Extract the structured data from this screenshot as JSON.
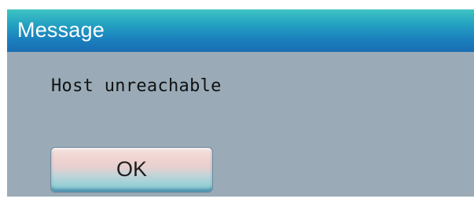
{
  "dialog": {
    "title": "Message",
    "message": "Host unreachable",
    "ok_label": "OK"
  }
}
